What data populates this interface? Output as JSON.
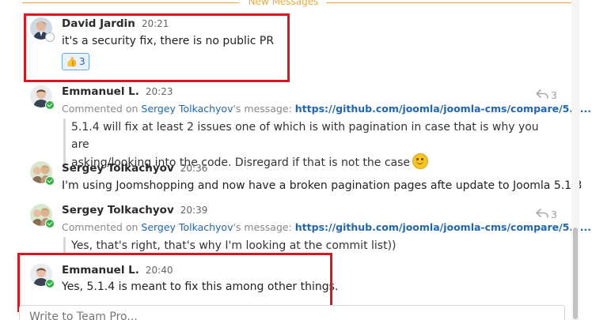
{
  "divider": {
    "label": "New Messages"
  },
  "messages": [
    {
      "author": "David Jardin",
      "time": "20:21",
      "status": "offline",
      "text": "it's a security fix, there is no public PR",
      "reaction": {
        "emoji": "👍",
        "count": "3"
      }
    },
    {
      "author": "Emmanuel L.",
      "time": "20:23",
      "status": "online",
      "reply": {
        "prefix": "Commented on ",
        "target_author": "Sergey Tolkachyov",
        "suffix": "'s message: ",
        "link": "https://github.com/joomla/joomla-cms/compare/5.1..."
      },
      "quote_line1": "5.1.4 will fix at least 2 issues one of which is with pagination in case that is why you are",
      "quote_line2": "asking/looking into the code. Disregard if that is not the case",
      "reply_count": "3"
    },
    {
      "author": "Sergey Tolkachyov",
      "time": "20:36",
      "status": "online",
      "text": "I'm using Joomshopping and now have a broken pagination pages afte update to Joomla 5.1.3"
    },
    {
      "author": "Sergey Tolkachyov",
      "time": "20:39",
      "status": "online",
      "reply": {
        "prefix": "Commented on ",
        "target_author": "Sergey Tolkachyov",
        "suffix": "'s message: ",
        "link": "https://github.com/joomla/joomla-cms/compare/5.1..."
      },
      "quote_line1": "Yes, that's right, that's why I'm looking at the commit list))",
      "reply_count": "3"
    },
    {
      "author": "Emmanuel L.",
      "time": "20:40",
      "status": "online",
      "text": "Yes, 5.1.4 is meant to fix this among other things."
    }
  ],
  "composer": {
    "placeholder": "Write to Team Pro..."
  },
  "colors": {
    "accent": "#f2a93b",
    "link": "#1f66b5",
    "online": "#2fb344",
    "highlight": "#e0141e"
  },
  "icons": {
    "reply": "reply-arrow-icon",
    "smile": "smiley-icon",
    "status_online": "check-status-icon",
    "status_offline": "offline-status-icon"
  }
}
